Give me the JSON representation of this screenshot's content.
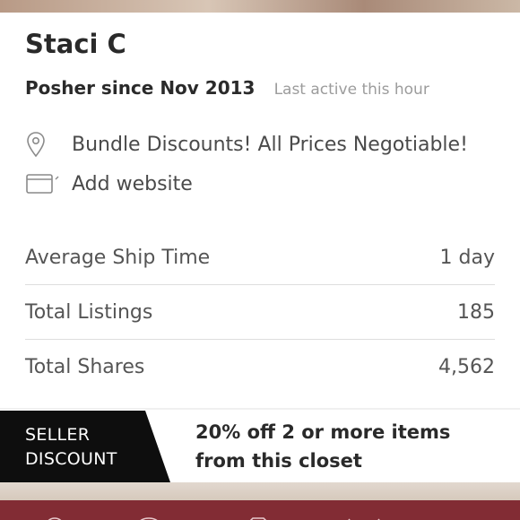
{
  "profile": {
    "name": "Staci C",
    "posher_since": "Posher since Nov 2013",
    "last_active": "Last active this hour",
    "location_text": "Bundle Discounts! All Prices Negotiable!",
    "website_text": "Add website"
  },
  "stats": [
    {
      "label": "Average Ship Time",
      "value": "1 day"
    },
    {
      "label": "Total Listings",
      "value": "185"
    },
    {
      "label": "Total Shares",
      "value": "4,562"
    }
  ],
  "discount": {
    "tag_line1": "SELLER",
    "tag_line2": "DISCOUNT",
    "description": "20% off 2 or more items from this closet"
  },
  "nav": {
    "icons": [
      "feed-icon",
      "search-icon",
      "camera-icon",
      "share-icon",
      "menu-icon"
    ],
    "bar_color": "#822c34"
  },
  "colors": {
    "accent": "#822c34",
    "tag_bg": "#0e0e0e"
  }
}
